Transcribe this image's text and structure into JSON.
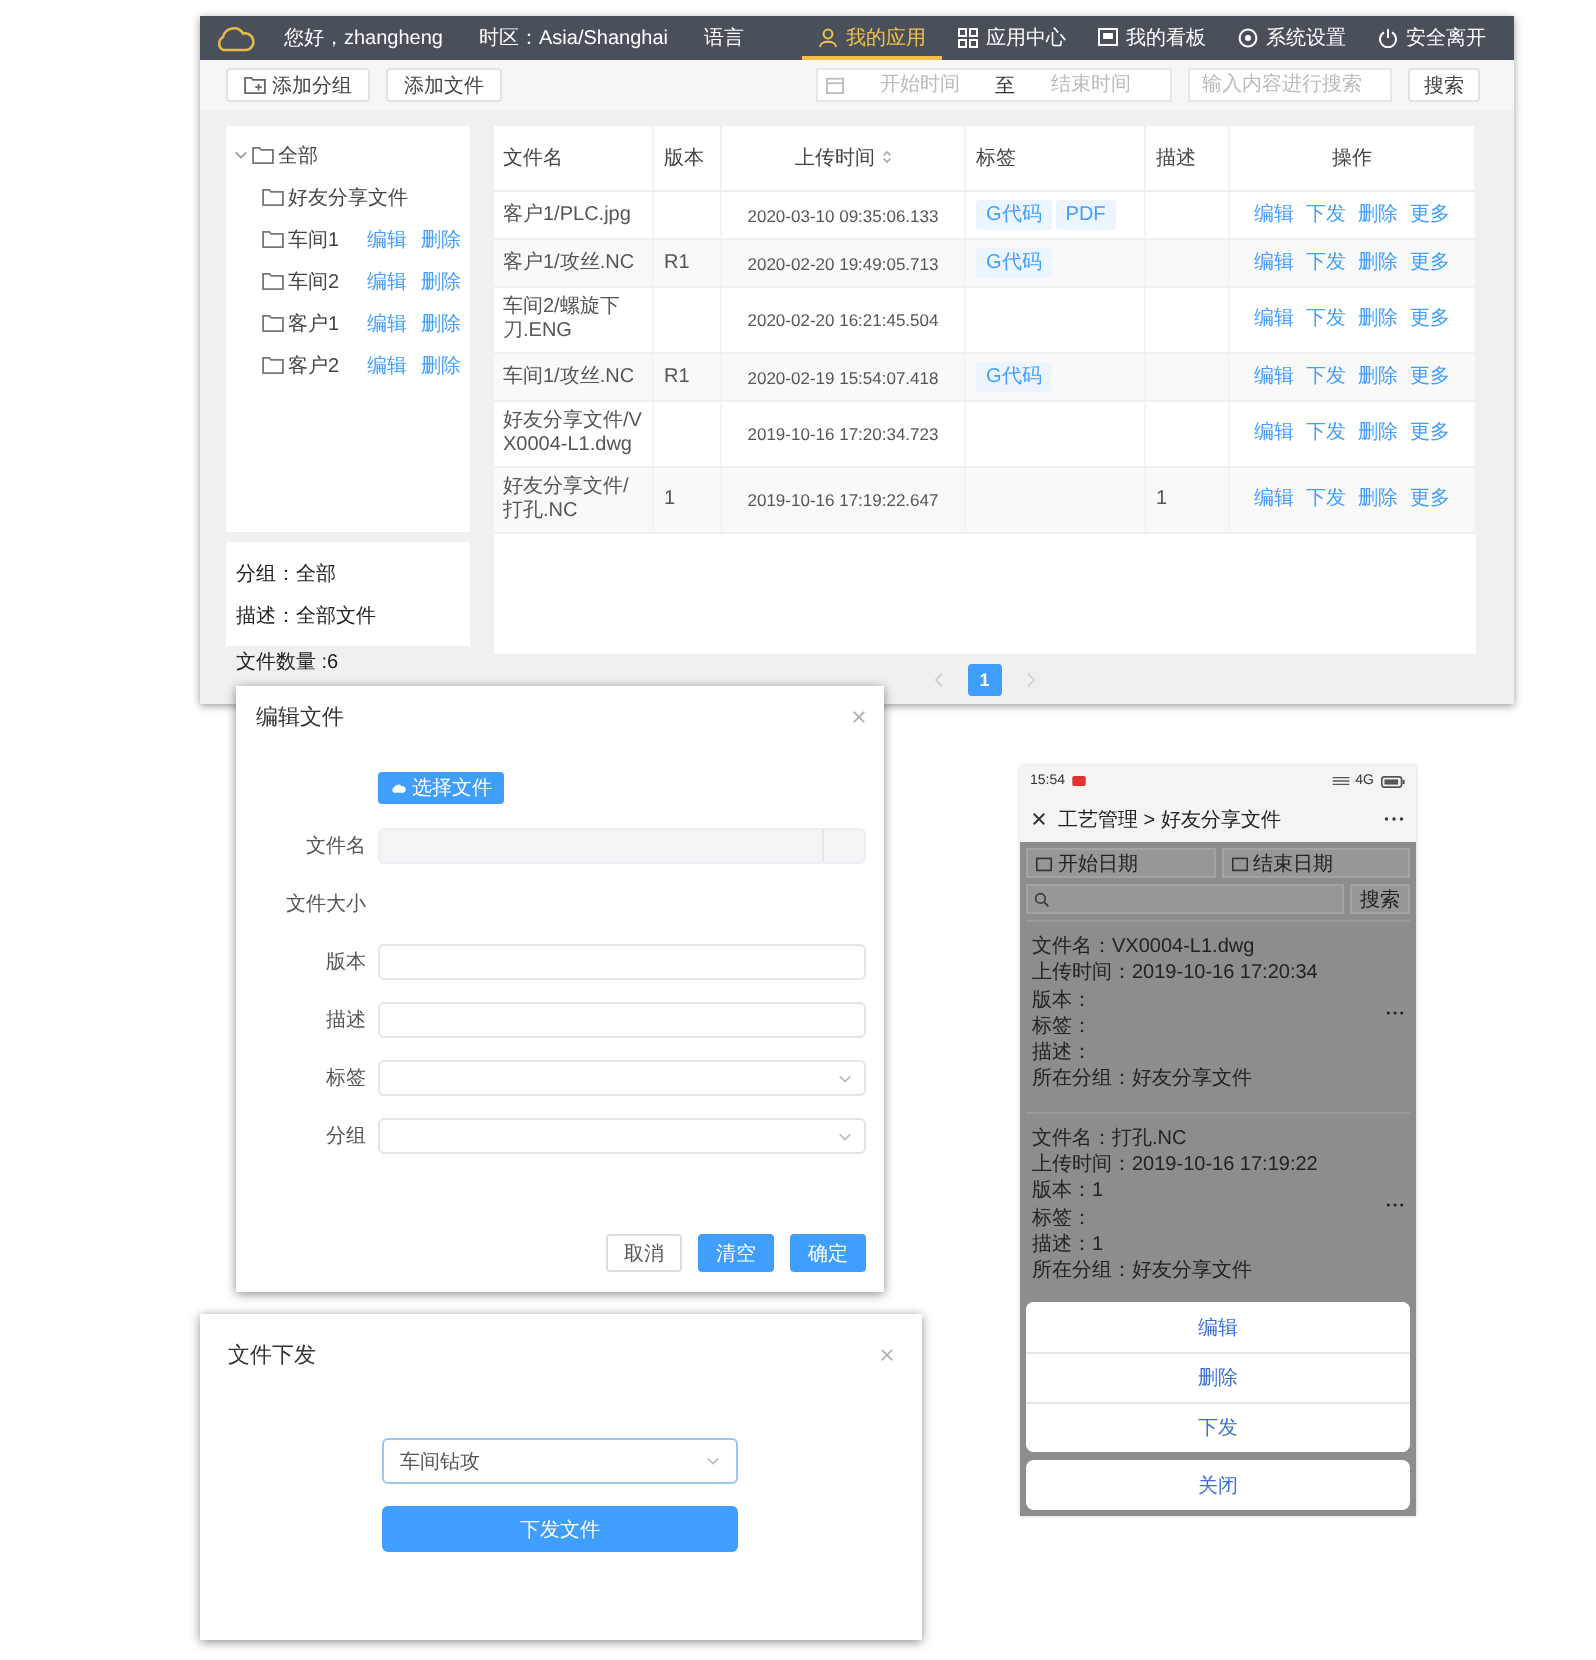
{
  "header": {
    "greeting": "您好，zhangheng",
    "timezone": "时区：Asia/Shanghai",
    "language": "语言",
    "nav": [
      {
        "label": "我的应用",
        "selected": true
      },
      {
        "label": "应用中心",
        "selected": false
      },
      {
        "label": "我的看板",
        "selected": false
      },
      {
        "label": "系统设置",
        "selected": false
      },
      {
        "label": "安全离开",
        "selected": false
      }
    ]
  },
  "toolbar": {
    "buttons": [
      "添加分组",
      "添加文件"
    ],
    "date_range": {
      "start_placeholder": "开始时间",
      "separator": "至",
      "end_placeholder": "结束时间"
    },
    "search": {
      "placeholder": "输入内容进行搜索"
    },
    "search_button": "搜索"
  },
  "sidebar": {
    "tree": [
      {
        "label": "全部",
        "expanded": true,
        "children": [
          {
            "label": "好友分享文件"
          },
          {
            "label": "车间1",
            "actions": [
              "编辑",
              "删除"
            ]
          },
          {
            "label": "车间2",
            "actions": [
              "编辑",
              "删除"
            ]
          },
          {
            "label": "客户1",
            "actions": [
              "编辑",
              "删除"
            ]
          },
          {
            "label": "客户2",
            "actions": [
              "编辑",
              "删除"
            ]
          }
        ]
      }
    ],
    "info": [
      "分组：全部",
      "描述：全部文件"
    ],
    "count": "文件数量 :6"
  },
  "table": {
    "columns": [
      "文件名",
      "版本",
      "上传时间",
      "标签",
      "描述",
      "操作"
    ],
    "rows": [
      {
        "file": "客户1/PLC.jpg",
        "time": "2020-03-10 09:35:06.133",
        "tags": [
          "G代码",
          "PDF"
        ],
        "actions": [
          "编辑",
          "下发",
          "删除",
          "更多"
        ]
      },
      {
        "file": "客户1/攻丝.NC",
        "version": "R1",
        "time": "2020-02-20 19:49:05.713",
        "tags": [
          "G代码"
        ],
        "actions": [
          "编辑",
          "下发",
          "删除",
          "更多"
        ]
      },
      {
        "file": "车间2/螺旋下刀.ENG",
        "time": "2020-02-20 16:21:45.504",
        "actions": [
          "编辑",
          "下发",
          "删除",
          "更多"
        ]
      },
      {
        "file": "车间1/攻丝.NC",
        "version": "R1",
        "time": "2020-02-19 15:54:07.418",
        "tags": [
          "G代码"
        ],
        "actions": [
          "编辑",
          "下发",
          "删除",
          "更多"
        ]
      },
      {
        "file": "好友分享文件/VX0004-L1.dwg",
        "time": "2019-10-16 17:20:34.723",
        "actions": [
          "编辑",
          "下发",
          "删除",
          "更多"
        ]
      },
      {
        "file": "好友分享文件/打孔.NC",
        "version": "1",
        "time": "2019-10-16 17:19:22.647",
        "description": "1",
        "actions": [
          "编辑",
          "下发",
          "删除",
          "更多"
        ]
      }
    ]
  },
  "pagination": {
    "pages": [
      {
        "label": "1",
        "selected": true
      }
    ]
  },
  "edit_dialog": {
    "title": "编辑文件",
    "upload_button": "选择文件",
    "fields": [
      {
        "label": "文件名",
        "kind": "disabled"
      },
      {
        "label": "文件大小",
        "kind": "text"
      },
      {
        "label": "版本",
        "kind": "input"
      },
      {
        "label": "描述",
        "kind": "input"
      },
      {
        "label": "标签",
        "kind": "select"
      },
      {
        "label": "分组",
        "kind": "select"
      }
    ],
    "buttons": [
      {
        "label": "取消",
        "kind": "plain"
      },
      {
        "label": "清空",
        "kind": "primary"
      },
      {
        "label": "确定",
        "kind": "primary"
      }
    ]
  },
  "mobile": {
    "status_time": "15:54",
    "network": "4G",
    "title": "工艺管理 > 好友分享文件",
    "filters": {
      "start": "开始日期",
      "end": "结束日期",
      "search_button": "搜索"
    },
    "cards": [
      {
        "lines": [
          "文件名：VX0004-L1.dwg",
          "上传时间：2019-10-16 17:20:34",
          "版本：",
          "标签：",
          "描述：",
          "所在分组：好友分享文件"
        ]
      },
      {
        "lines": [
          "文件名：打孔.NC",
          "上传时间：2019-10-16 17:19:22",
          "版本：1",
          "标签：",
          "描述：1",
          "所在分组：好友分享文件"
        ]
      }
    ],
    "action_sheet": {
      "actions": [
        "编辑",
        "删除",
        "下发"
      ],
      "cancel": "关闭"
    }
  },
  "dispatch_dialog": {
    "title": "文件下发",
    "select": {
      "value": "车间钻攻"
    },
    "button": "下发文件"
  }
}
